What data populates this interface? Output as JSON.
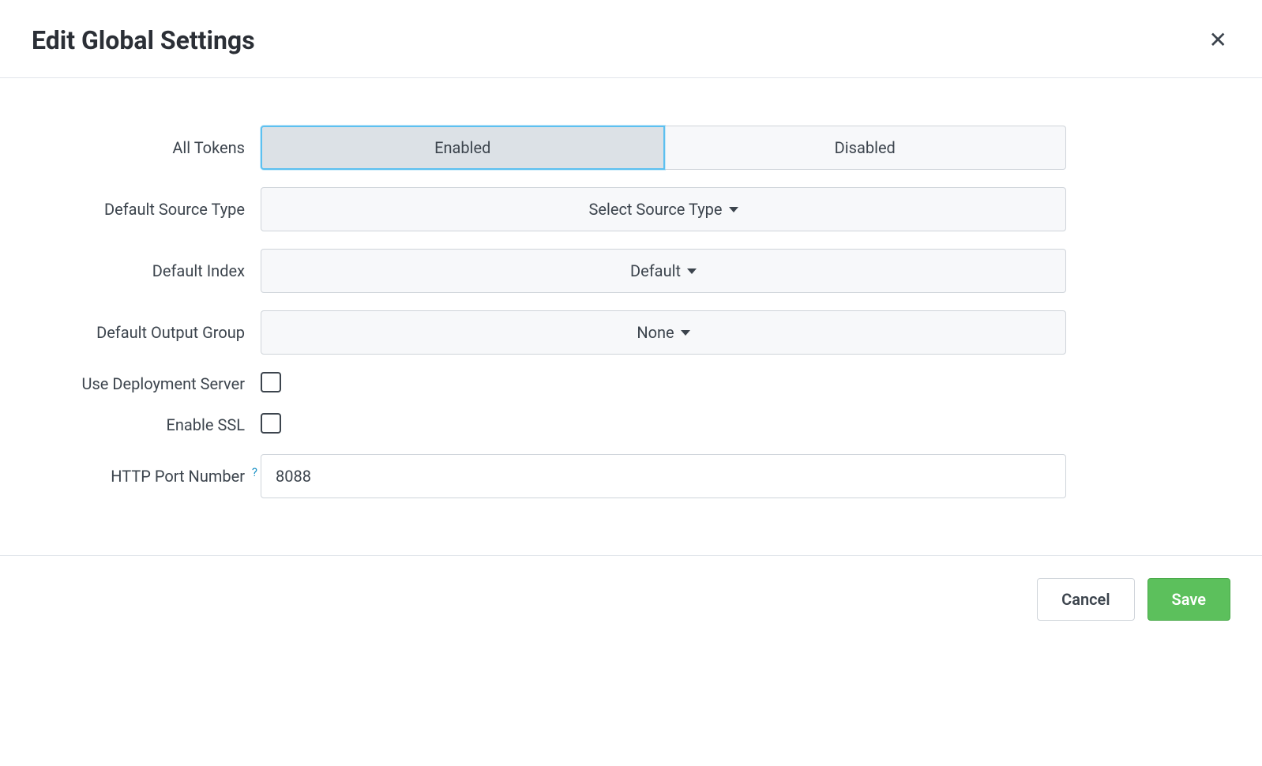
{
  "header": {
    "title": "Edit Global Settings"
  },
  "form": {
    "all_tokens": {
      "label": "All Tokens",
      "enabled_label": "Enabled",
      "disabled_label": "Disabled",
      "value": "enabled"
    },
    "default_source_type": {
      "label": "Default Source Type",
      "selected": "Select Source Type"
    },
    "default_index": {
      "label": "Default Index",
      "selected": "Default"
    },
    "default_output_group": {
      "label": "Default Output Group",
      "selected": "None"
    },
    "use_deployment_server": {
      "label": "Use Deployment Server",
      "checked": false
    },
    "enable_ssl": {
      "label": "Enable SSL",
      "checked": false
    },
    "http_port_number": {
      "label": "HTTP Port Number",
      "help": "?",
      "value": "8088"
    }
  },
  "footer": {
    "cancel": "Cancel",
    "save": "Save"
  }
}
